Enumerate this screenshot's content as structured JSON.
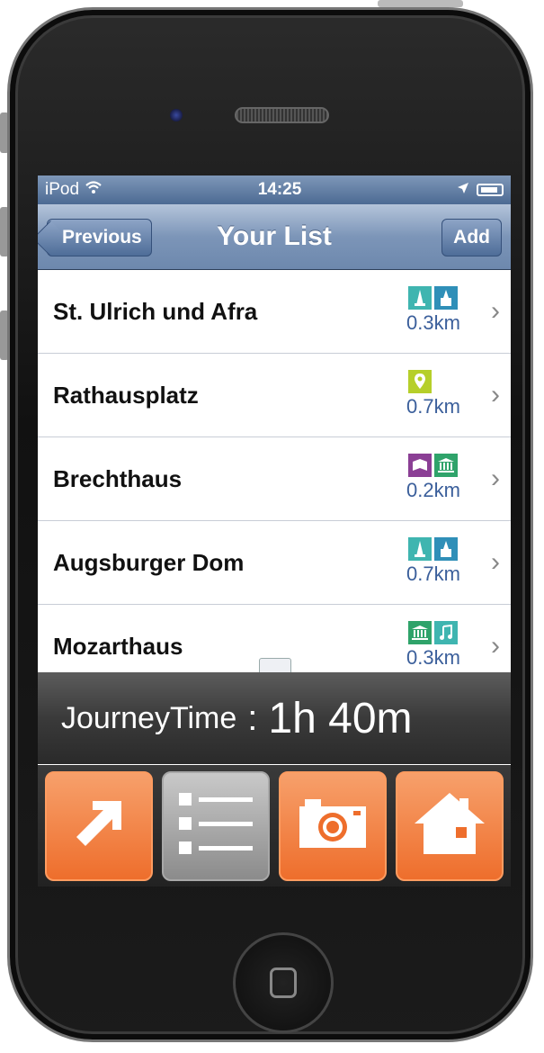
{
  "status_bar": {
    "carrier": "iPod",
    "time": "14:25"
  },
  "nav": {
    "back_label": "Previous",
    "title": "Your List",
    "add_label": "Add"
  },
  "items": [
    {
      "name": "St. Ulrich und Afra",
      "distance": "0.3km",
      "icons": [
        "church-icon",
        "church-icon"
      ]
    },
    {
      "name": "Rathausplatz",
      "distance": "0.7km",
      "icons": [
        "location-pin-icon"
      ]
    },
    {
      "name": "Brechthaus",
      "distance": "0.2km",
      "icons": [
        "book-icon",
        "museum-icon"
      ]
    },
    {
      "name": "Augsburger Dom",
      "distance": "0.7km",
      "icons": [
        "church-icon",
        "church-icon"
      ]
    },
    {
      "name": "Mozarthaus",
      "distance": "0.3km",
      "icons": [
        "museum-icon",
        "music-note-icon"
      ]
    }
  ],
  "journey": {
    "label": "JourneyTime",
    "separator": ":",
    "value": "1h 40m"
  },
  "tabs": [
    "arrow-navigate-icon",
    "list-icon",
    "camera-icon",
    "home-icon"
  ],
  "colors": {
    "accent_orange": "#ee6e2c",
    "nav_blue": "#6d88ad",
    "church": "#3fb5b0",
    "location": "#b6cf2a",
    "book": "#8b3f95",
    "museum": "#2fa36a",
    "music": "#3fb5b0",
    "distance_text": "#3b5f9b"
  }
}
